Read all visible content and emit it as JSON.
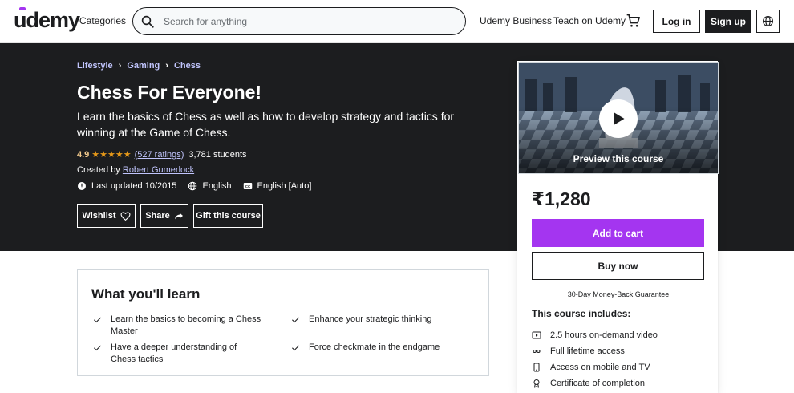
{
  "header": {
    "logo": "udemy",
    "categories": "Categories",
    "search_placeholder": "Search for anything",
    "business": "Udemy Business",
    "teach": "Teach on Udemy",
    "login": "Log in",
    "signup": "Sign up"
  },
  "breadcrumb": [
    "Lifestyle",
    "Gaming",
    "Chess"
  ],
  "course": {
    "title": "Chess For Everyone!",
    "subtitle": "Learn the basics of Chess as well as how to develop strategy and tactics for winning at the Game of Chess.",
    "rating": "4.9",
    "stars": "★★★★★",
    "ratings_count": "(527 ratings)",
    "students": "3,781 students",
    "created_by_label": "Created by",
    "instructor": "Robert Gumerlock",
    "last_updated": "Last updated 10/2015",
    "language": "English",
    "captions": "English [Auto]"
  },
  "actions": {
    "wishlist": "Wishlist",
    "share": "Share",
    "gift": "Gift this course"
  },
  "card": {
    "preview_label": "Preview this course",
    "price": "₹1,280",
    "add_to_cart": "Add to cart",
    "buy_now": "Buy now",
    "guarantee": "30-Day Money-Back Guarantee",
    "includes_title": "This course includes:",
    "includes": [
      {
        "icon": "video-icon",
        "text": "2.5 hours on-demand video"
      },
      {
        "icon": "infinity-icon",
        "text": "Full lifetime access"
      },
      {
        "icon": "mobile-icon",
        "text": "Access on mobile and TV"
      },
      {
        "icon": "certificate-icon",
        "text": "Certificate of completion"
      }
    ]
  },
  "learn": {
    "title": "What you'll learn",
    "items": [
      "Learn the basics to becoming a Chess Master",
      "Enhance your strategic thinking",
      "Have a deeper understanding of Chess tactics",
      "Force checkmate in the endgame"
    ]
  },
  "colors": {
    "brand_purple": "#a435f0",
    "dark_bg": "#1c1d1f",
    "link_purple": "#c0c4fc",
    "star_orange": "#e59819",
    "rating_gold": "#f3ca8c"
  }
}
